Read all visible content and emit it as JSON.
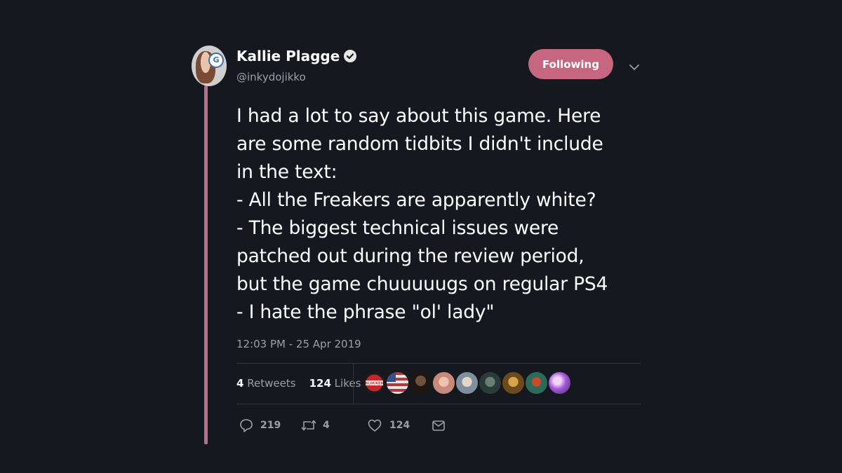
{
  "author": {
    "name": "Kallie Plagge",
    "handle": "@inkydojikko",
    "verified": true
  },
  "follow_button": {
    "label": "Following",
    "color": "#c7677f"
  },
  "tweet": {
    "text": "I had a lot to say about this game. Here\nare some random tidbits I didn't include\nin the text:\n- All the Freakers are apparently white?\n- The biggest technical issues were\npatched out during the review period,\nbut the game chuuuuugs on regular PS4\n- I hate the phrase \"ol' lady\"",
    "timestamp": "12:03 PM - 25 Apr 2019"
  },
  "stats": {
    "retweets_count": "4",
    "retweets_label": "Retweets",
    "likes_count": "124",
    "likes_label": "Likes"
  },
  "liker_avatars": [
    {
      "icon": "blocked-sticker-avatar",
      "text": "BLOCKED"
    },
    {
      "icon": "flag-avatar"
    },
    {
      "icon": "dark-portrait-avatar"
    },
    {
      "icon": "pink-portrait-avatar"
    },
    {
      "icon": "light-portrait-avatar"
    },
    {
      "icon": "teal-portrait-avatar"
    },
    {
      "icon": "gold-portrait-avatar"
    },
    {
      "icon": "character-avatar"
    },
    {
      "icon": "purple-orb-avatar"
    }
  ],
  "actions": {
    "reply_count": "219",
    "retweet_count": "4",
    "like_count": "124"
  },
  "colors": {
    "background": "#15181f",
    "accent": "#c7677f",
    "thread_line": "#b86f8a",
    "muted_text": "#9aa0a8"
  }
}
